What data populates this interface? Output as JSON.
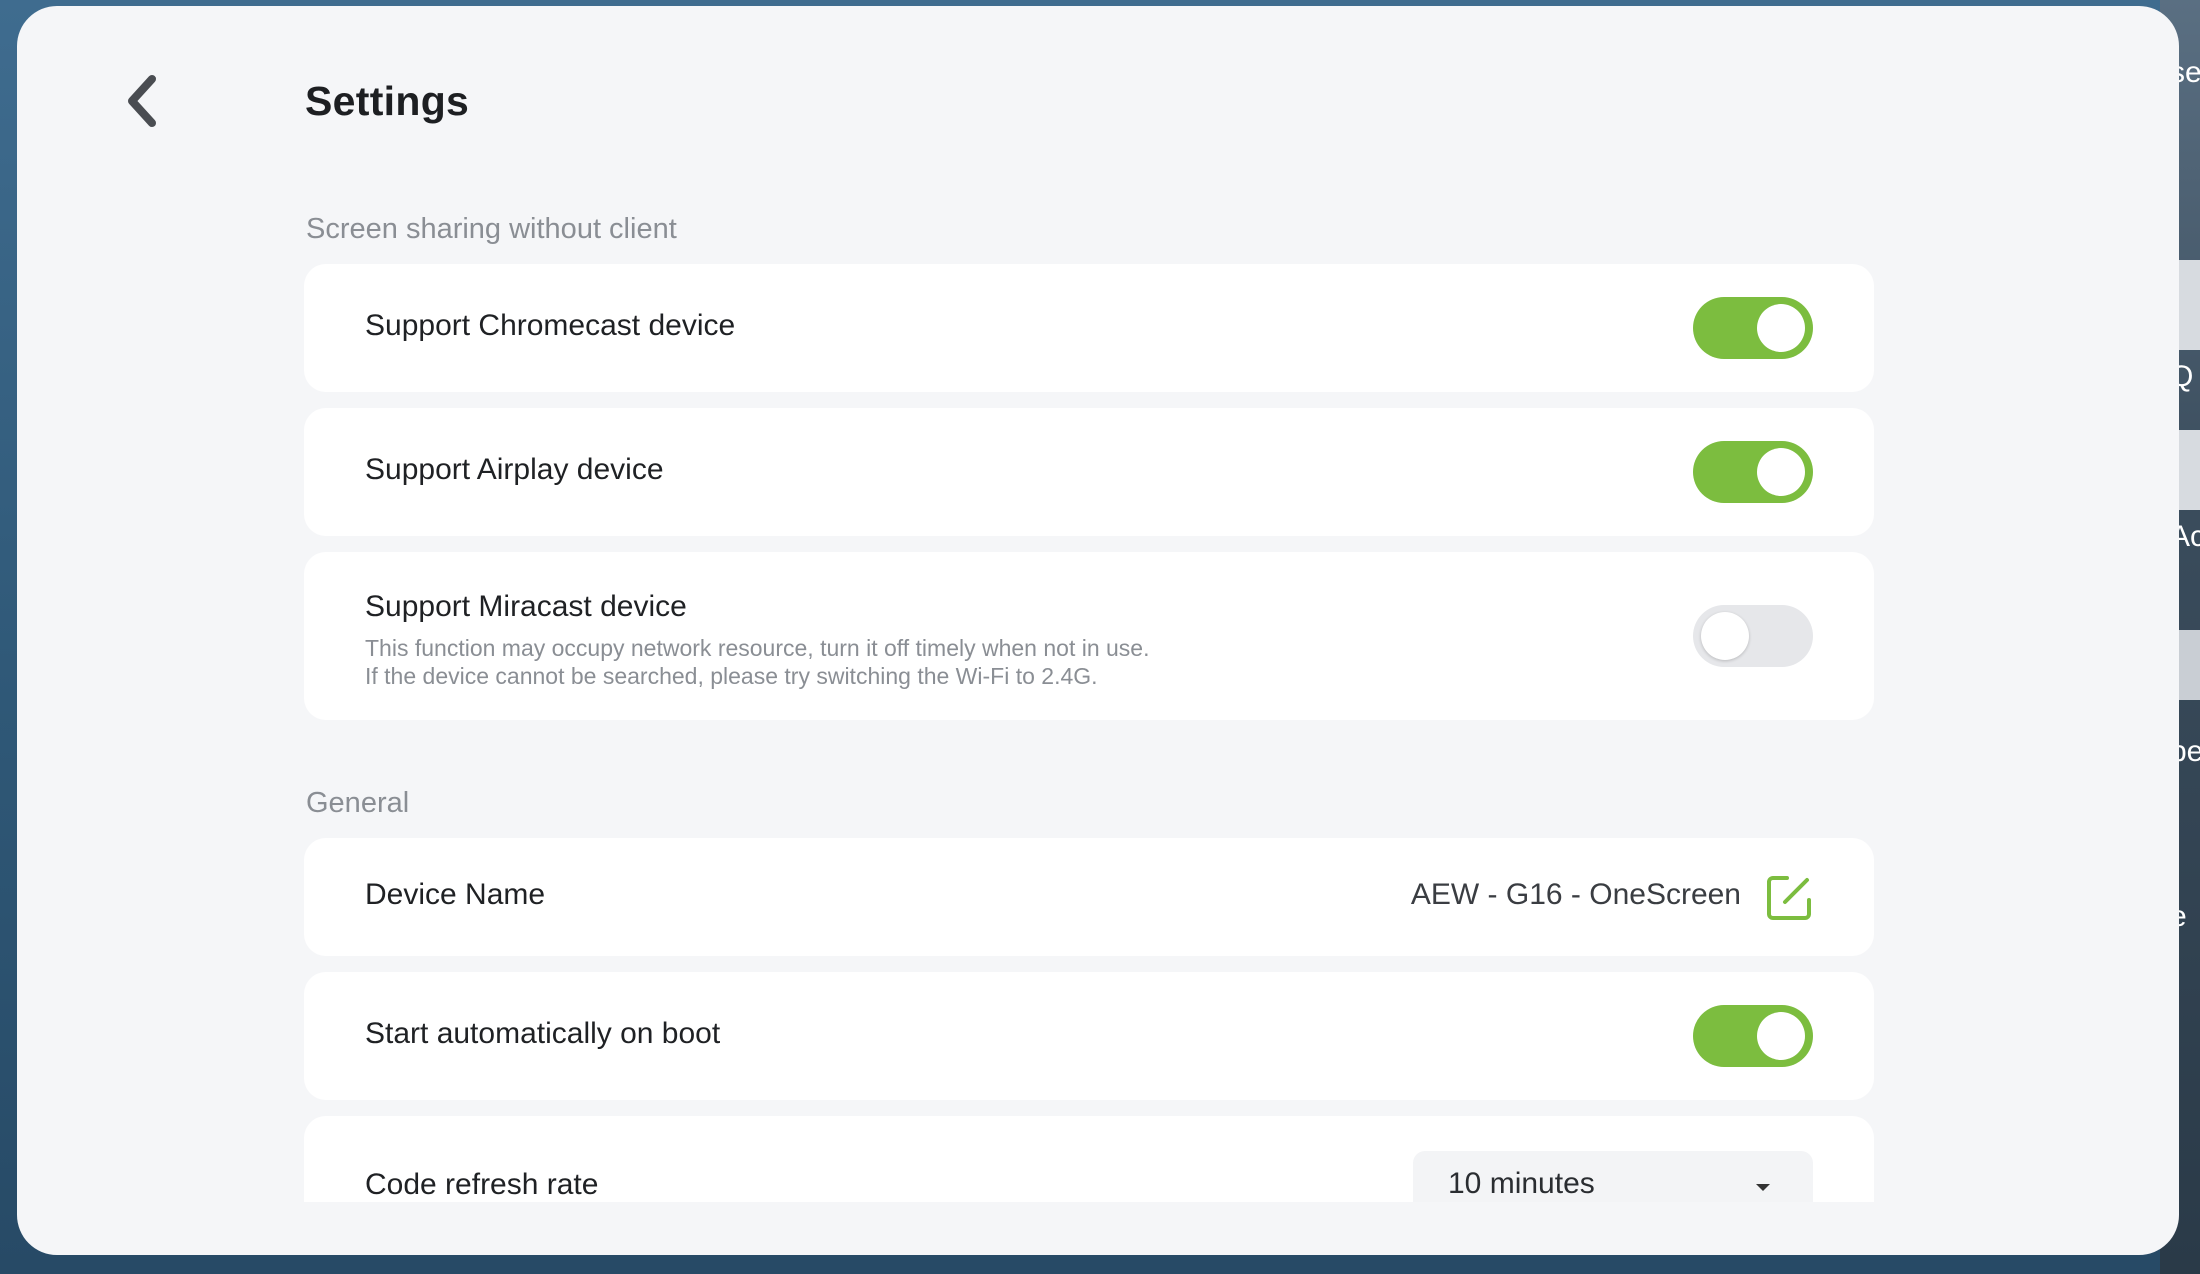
{
  "page": {
    "title": "Settings"
  },
  "sections": {
    "screen_sharing": {
      "label": "Screen sharing without client",
      "chromecast": {
        "label": "Support Chromecast device",
        "enabled": true
      },
      "airplay": {
        "label": "Support Airplay device",
        "enabled": true
      },
      "miracast": {
        "label": "Support Miracast device",
        "desc_line1": "This function may occupy network resource, turn it off timely when not in use.",
        "desc_line2": "If the device cannot be searched, please try switching the Wi-Fi to 2.4G.",
        "enabled": false
      }
    },
    "general": {
      "label": "General",
      "device_name": {
        "label": "Device Name",
        "value": "AEW - G16 - OneScreen"
      },
      "autostart": {
        "label": "Start automatically on boot",
        "enabled": true
      },
      "code_refresh": {
        "label": "Code refresh rate",
        "value": "10 minutes"
      }
    }
  },
  "colors": {
    "accent_green": "#7cbd3f",
    "toggle_off": "#e6e7ea",
    "background": "#f5f6f8"
  },
  "background_fragments": [
    "se",
    "Q",
    "Ac",
    "pe",
    "e"
  ],
  "icons": {
    "back": "chevron-left-icon",
    "edit": "edit-icon",
    "dropdown": "caret-down-icon"
  }
}
